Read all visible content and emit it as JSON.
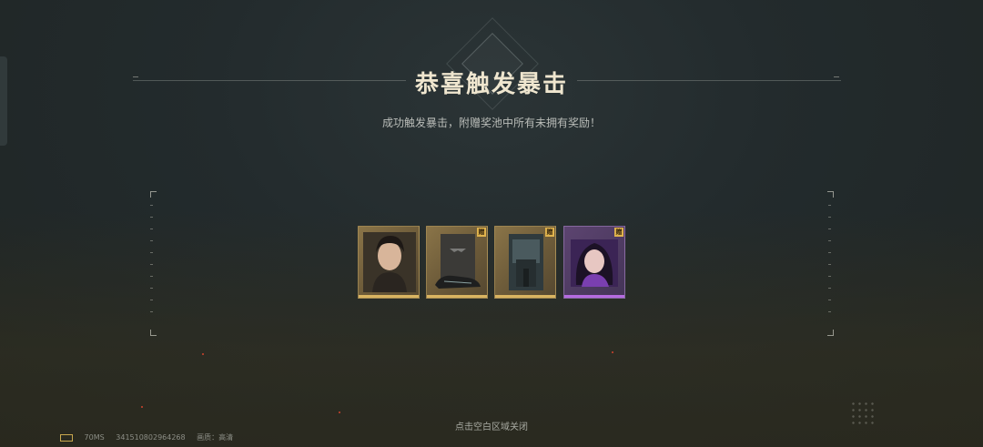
{
  "title": "恭喜触发暴击",
  "subtitle": "成功触发暴击，附赠奖池中所有未拥有奖励！",
  "close_hint": "点击空白区域关闭",
  "status": {
    "ping": "70MS",
    "user_id": "3415108029642​68",
    "quality": "画质：高清"
  },
  "cards": [
    {
      "name": "character-portrait",
      "badge": "",
      "rarity": "gold",
      "icon": "male-character-icon"
    },
    {
      "name": "gear-item",
      "badge": "赠",
      "rarity": "gold",
      "icon": "shoe-item-icon"
    },
    {
      "name": "scene-item",
      "badge": "赠",
      "rarity": "gold",
      "icon": "scene-icon"
    },
    {
      "name": "avatar-item",
      "badge": "赠",
      "rarity": "purple",
      "icon": "female-character-icon"
    }
  ],
  "colors": {
    "gold": "#d9b461",
    "purple": "#b56be0",
    "title": "#efe6cf"
  }
}
